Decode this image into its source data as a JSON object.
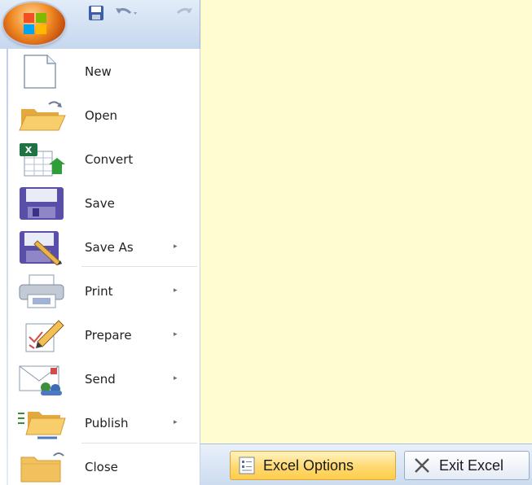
{
  "menu": {
    "items": [
      {
        "label": "New",
        "icon": "new-document-icon",
        "submenu": false
      },
      {
        "label": "Open",
        "icon": "open-folder-icon",
        "submenu": false
      },
      {
        "label": "Convert",
        "icon": "convert-workbook-icon",
        "submenu": false
      },
      {
        "label": "Save",
        "icon": "save-disk-icon",
        "submenu": false
      },
      {
        "label": "Save As",
        "icon": "save-as-icon",
        "submenu": true
      },
      {
        "label": "Print",
        "icon": "printer-icon",
        "submenu": true
      },
      {
        "label": "Prepare",
        "icon": "prepare-pencil-icon",
        "submenu": true
      },
      {
        "label": "Send",
        "icon": "send-mail-icon",
        "submenu": true
      },
      {
        "label": "Publish",
        "icon": "publish-folder-icon",
        "submenu": true
      },
      {
        "label": "Close",
        "icon": "close-folder-icon",
        "submenu": false
      }
    ],
    "submenu_arrow": "▸"
  },
  "quick_access": {
    "icons": [
      "office-button-icon",
      "save-icon",
      "undo-icon",
      "redo-icon"
    ]
  },
  "footer": {
    "options_label": "Excel Options",
    "exit_label": "Exit Excel"
  },
  "colors": {
    "background": "#fffdd0",
    "options_button": "#ffd971",
    "exit_button": "#e4ebf5"
  }
}
